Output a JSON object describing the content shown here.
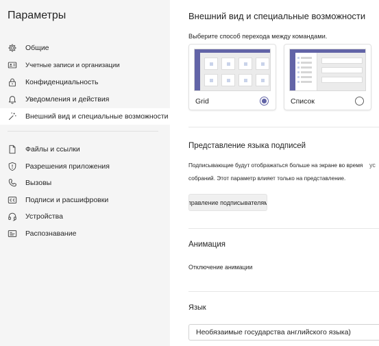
{
  "sidebar": {
    "title": "Параметры",
    "items": [
      {
        "label": "Общие",
        "icon": "gear-icon"
      },
      {
        "label": "Учетные записи и организации",
        "icon": "id-card-icon"
      },
      {
        "label": "Конфиденциальность",
        "icon": "lock-icon"
      },
      {
        "label": "Уведомления и действия",
        "icon": "bell-icon"
      },
      {
        "label": "Внешний вид и специальные возможности",
        "icon": "magic-wand-icon",
        "active": true
      },
      {
        "label": "Файлы и ссылки",
        "icon": "file-icon"
      },
      {
        "label": "Разрешения приложения",
        "icon": "shield-icon"
      },
      {
        "label": "Вызовы",
        "icon": "phone-icon"
      },
      {
        "label": "Подписи и расшифровки",
        "icon": "closed-captions-icon"
      },
      {
        "label": "Устройства",
        "icon": "headset-icon"
      },
      {
        "label": "Распознавание",
        "icon": "recognition-icon"
      }
    ]
  },
  "main": {
    "title": "Внешний вид и специальные возможности",
    "layout": {
      "prompt": "Выберите способ перехода между командами.",
      "options": [
        {
          "label": "Grid",
          "selected": true
        },
        {
          "label": "Список",
          "selected": false
        }
      ]
    },
    "captions": {
      "title": "Представление языка подписей",
      "line1": "Подписывающие будут отображаться больше на экране во время",
      "line2": "собраний. Этот параметр влияет только на представление.",
      "overflow": "ус",
      "button": "Управление подписывателями"
    },
    "animation": {
      "title": "Анимация",
      "text": "Отключение анимации"
    },
    "language": {
      "title": "Язык",
      "selected": "Необязаимые государства английского языка)"
    }
  },
  "colors": {
    "accent": "#6264a7",
    "sidebar_bg": "#f5f5f5"
  }
}
